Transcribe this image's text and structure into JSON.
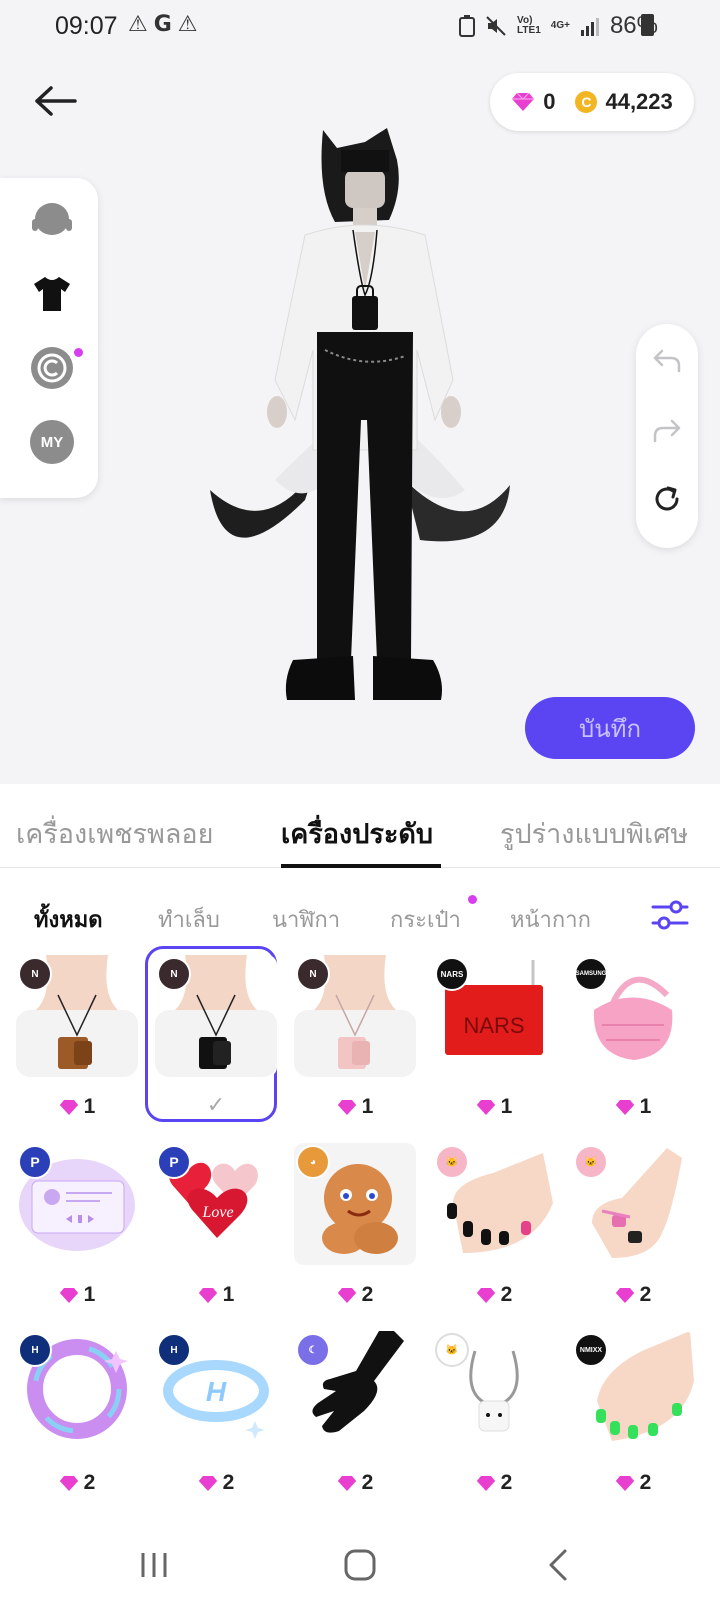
{
  "status_bar": {
    "time": "09:07",
    "left_icons": [
      "warning-icon",
      "google-icon",
      "warning-icon"
    ],
    "network_label_top": "Vo)",
    "network_label_bottom": "LTE1",
    "network_type": "4G+",
    "battery": "86%"
  },
  "currency": {
    "gems": "0",
    "coins": "44,223",
    "gem_color": "#e83fd1",
    "coin_color": "#f2b623",
    "coin_symbol": "C"
  },
  "side_menu": {
    "items": [
      "hair-icon",
      "clothing-icon",
      "copyright-icon",
      "my-icon"
    ],
    "my_label": "MY"
  },
  "history": [
    "undo-icon",
    "redo-icon",
    "reset-icon"
  ],
  "save_label": "บันทึก",
  "accent_color": "#5b45f2",
  "category_tabs": [
    {
      "label": "เครื่องเพชรพลอย",
      "active": false
    },
    {
      "label": "เครื่องประดับ",
      "active": true
    },
    {
      "label": "รูปร่างแบบพิเศษ",
      "active": false
    }
  ],
  "subtabs": [
    {
      "label": "ทั้งหมด",
      "active": true
    },
    {
      "label": "ทำเล็บ",
      "active": false
    },
    {
      "label": "นาฬิกา",
      "active": false
    },
    {
      "label": "กระเป๋า",
      "active": false
    },
    {
      "label": "หน้ากาก",
      "active": false
    }
  ],
  "items": [
    {
      "price": "1",
      "brand": "N",
      "desc": "brown-bag-necklace"
    },
    {
      "price": "",
      "brand": "N",
      "desc": "black-bag-necklace",
      "selected": true,
      "check": "✓"
    },
    {
      "price": "1",
      "brand": "N",
      "desc": "pink-bag-necklace"
    },
    {
      "price": "1",
      "brand": "NARS",
      "desc": "red-nars-bag",
      "bag_text": "NARS"
    },
    {
      "price": "1",
      "brand": "SAMSUNG",
      "desc": "pink-shoulder-bag"
    },
    {
      "price": "1",
      "brand": "P",
      "desc": "music-player-item"
    },
    {
      "price": "1",
      "brand": "P",
      "desc": "love-hearts-item",
      "heart_text": "Love"
    },
    {
      "price": "2",
      "brand": "cookie",
      "desc": "cookie-plush"
    },
    {
      "price": "2",
      "brand": "kitty",
      "desc": "black-nail-art"
    },
    {
      "price": "2",
      "brand": "kitty",
      "desc": "ring-hand"
    },
    {
      "price": "2",
      "brand": "hyundai",
      "desc": "purple-halo-ring"
    },
    {
      "price": "2",
      "brand": "hyundai",
      "desc": "blue-hyundai-halo"
    },
    {
      "price": "2",
      "brand": "moon",
      "desc": "black-glove"
    },
    {
      "price": "2",
      "brand": "kitty-white",
      "desc": "white-phone-strap"
    },
    {
      "price": "2",
      "brand": "NMIXX",
      "desc": "green-nails"
    }
  ],
  "nav": [
    "recent-apps-icon",
    "home-icon",
    "back-icon"
  ]
}
